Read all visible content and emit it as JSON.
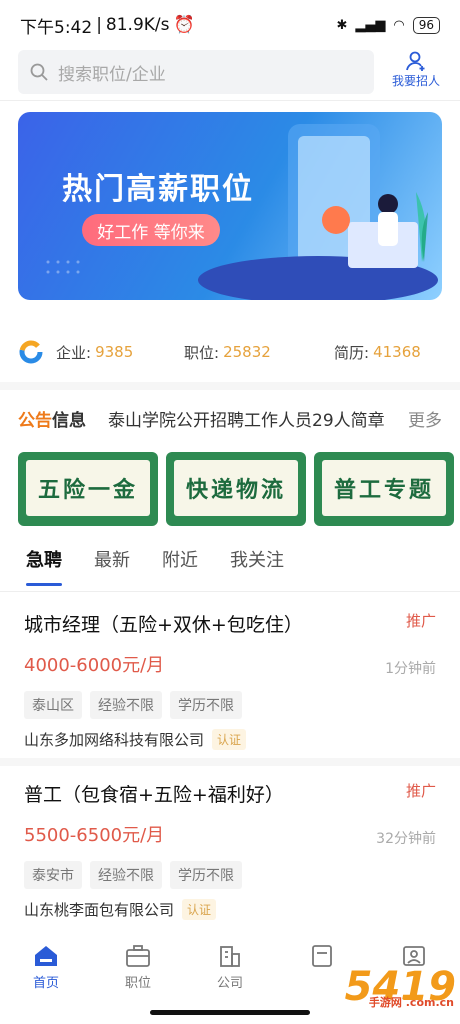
{
  "status": {
    "time": "下午5:42",
    "speed": "81.9K/s",
    "battery": "96"
  },
  "search": {
    "placeholder": "搜索职位/企业"
  },
  "recruit_label": "我要招人",
  "banner": {
    "title": "热门高薪职位",
    "pill": "好工作 等你来"
  },
  "stats": [
    {
      "label": "企业:",
      "value": "9385"
    },
    {
      "label": "职位:",
      "value": "25832"
    },
    {
      "label": "简历:",
      "value": "41368"
    }
  ],
  "notice": {
    "tag_a": "公告",
    "tag_b": "信息",
    "text": "泰山学院公开招聘工作人员29人简章",
    "more": "更多"
  },
  "categories": [
    "五险一金",
    "快递物流",
    "普工专题"
  ],
  "tabs": [
    "急聘",
    "最新",
    "附近",
    "我关注"
  ],
  "jobs": [
    {
      "title": "城市经理（五险+双休+包吃住）",
      "salary": "4000-6000元/月",
      "promo": "推广",
      "time": "1分钟前",
      "tags": [
        "泰山区",
        "经验不限",
        "学历不限"
      ],
      "company": "山东多加网络科技有限公司",
      "cert": "认证"
    },
    {
      "title": "普工（包食宿+五险+福利好）",
      "salary": "5500-6500元/月",
      "promo": "推广",
      "time": "32分钟前",
      "tags": [
        "泰安市",
        "经验不限",
        "学历不限"
      ],
      "company": "山东桃李面包有限公司",
      "cert": "认证"
    }
  ],
  "nav": [
    {
      "label": "首页",
      "icon": "home-icon"
    },
    {
      "label": "职位",
      "icon": "briefcase-icon"
    },
    {
      "label": "公司",
      "icon": "building-icon"
    },
    {
      "label": "",
      "icon": "document-icon"
    },
    {
      "label": "",
      "icon": "profile-icon"
    }
  ],
  "watermark": {
    "main": "5419",
    "sub": "手游网 .com.cn"
  },
  "colors": {
    "accent": "#2a5bd7",
    "salary": "#e05a4a",
    "stat": "#e6a23c",
    "category": "#2e8a52"
  }
}
